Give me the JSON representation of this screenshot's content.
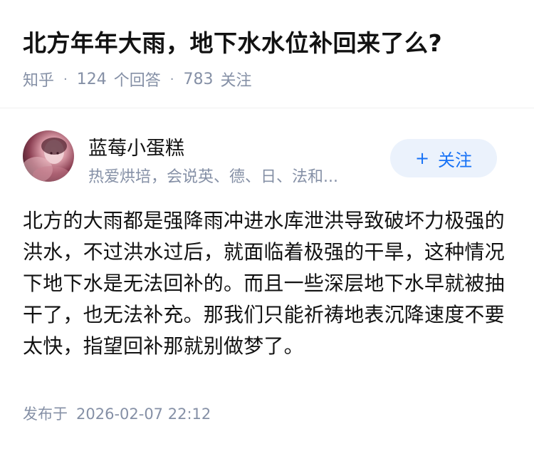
{
  "question": {
    "title": "北方年年大雨，地下水水位补回来了么?",
    "source": "知乎",
    "answer_count": "124",
    "answer_label": "个回答",
    "follower_count": "783",
    "follower_label": "关注"
  },
  "author": {
    "name": "蓝莓小蛋糕",
    "bio": "热爱烘培，会说英、德、日、法和...",
    "follow_plus": "+",
    "follow_label": "关注"
  },
  "answer": {
    "text": "北方的大雨都是强降雨冲进水库泄洪导致破坏力极强的洪水，不过洪水过后，就面临着极强的干旱，这种情况下地下水是无法回补的。而且一些深层地下水早就被抽干了，也无法补充。那我们只能祈祷地表沉降速度不要太快，指望回补那就别做梦了。"
  },
  "footer": {
    "publish_label": "发布于",
    "publish_time": "2026-02-07 22:12"
  },
  "colors": {
    "meta_gray": "#8590a6",
    "accent_blue": "#1772f6",
    "follow_bg": "#ebf2fc"
  }
}
